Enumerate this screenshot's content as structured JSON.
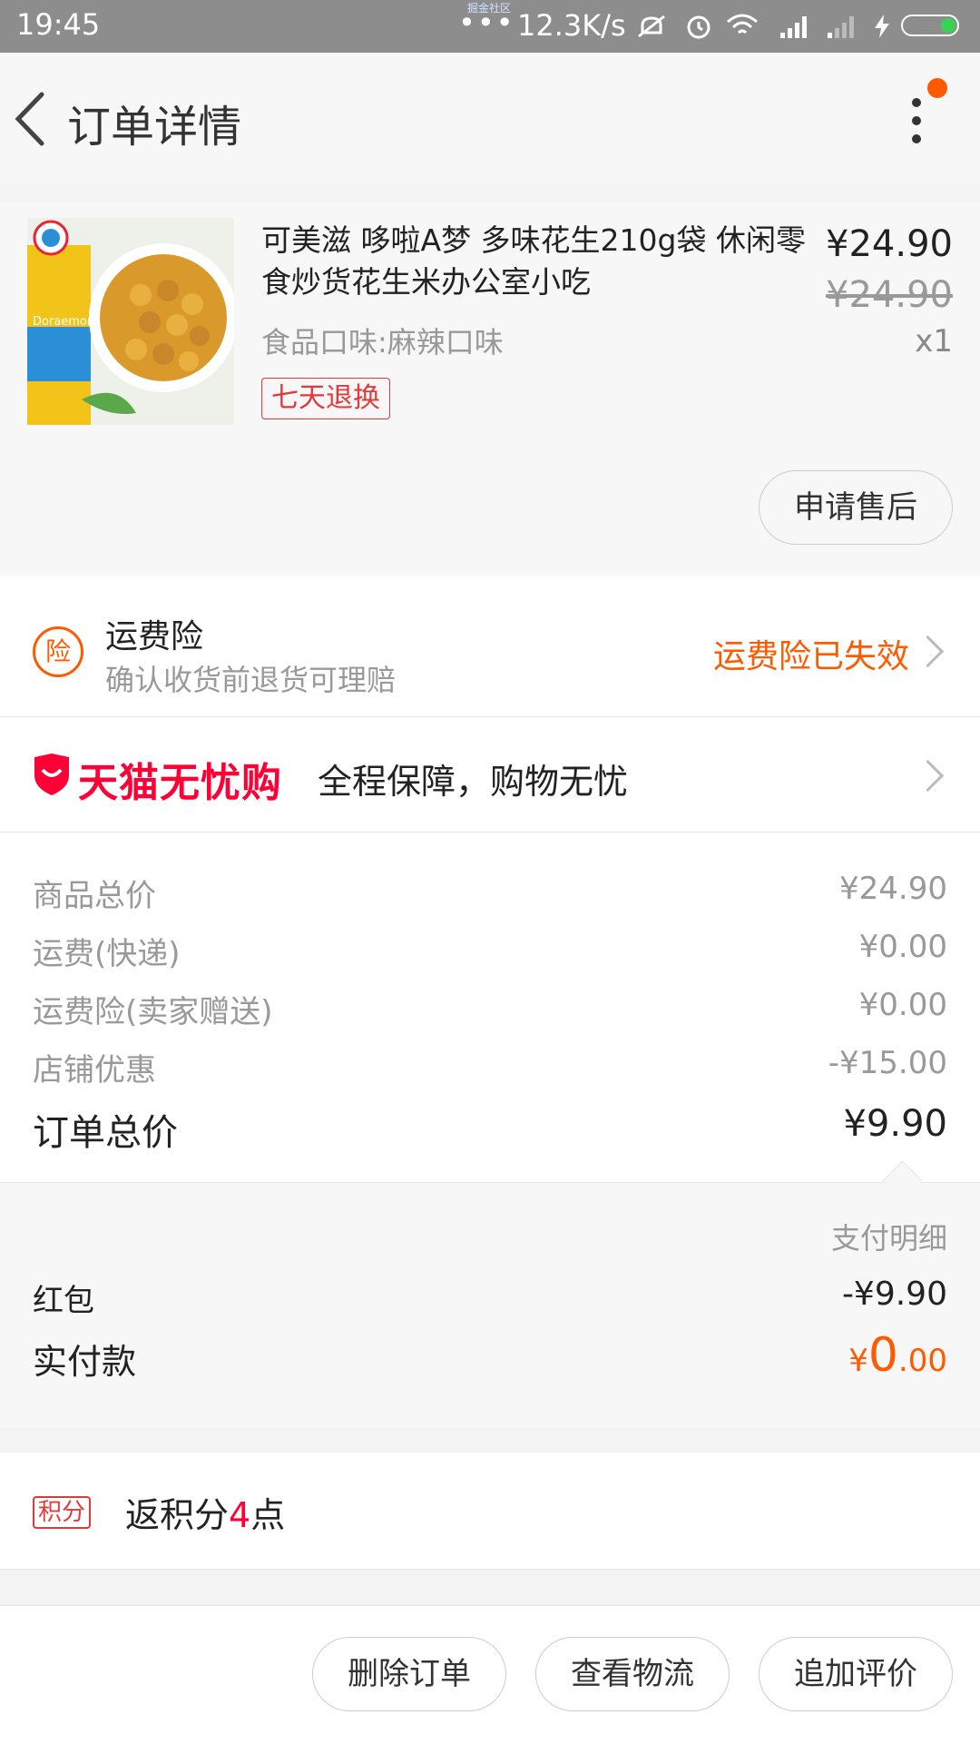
{
  "status_bar": {
    "time": "19:45",
    "tiny_text": "掘金社区",
    "dots": "•••",
    "network_speed": "12.3K/s",
    "battery_level_percent": 20
  },
  "header": {
    "title": "订单详情"
  },
  "product": {
    "title": "可美滋 哆啦A梦 多味花生210g袋 休闲零食炒货花生米办公室小吃",
    "spec": "食品口味:麻辣口味",
    "tag": "七天退换",
    "price": "¥24.90",
    "original_price": "¥24.90",
    "quantity": "x1",
    "after_sale_button": "申请售后",
    "thumb_brand_text": "Doraemon"
  },
  "freight_insurance": {
    "icon_label": "险",
    "title": "运费险",
    "subtitle": "确认收货前退货可理赔",
    "status": "运费险已失效"
  },
  "worry_free": {
    "brand": "天猫无忧购",
    "slogan": "全程保障，购物无忧"
  },
  "summary": {
    "rows": [
      {
        "label": "商品总价",
        "value": "¥24.90"
      },
      {
        "label": "运费(快递)",
        "value": "¥0.00"
      },
      {
        "label": "运费险(卖家赠送)",
        "value": "¥0.00"
      },
      {
        "label": "店铺优惠",
        "value": "-¥15.00"
      }
    ],
    "total_label": "订单总价",
    "total_value": "¥9.90"
  },
  "payment_detail": {
    "heading": "支付明细",
    "red_packet_label": "红包",
    "red_packet_value": "-¥9.90",
    "paid_label": "实付款",
    "paid_currency": "¥",
    "paid_integer": "0",
    "paid_decimal": ".00"
  },
  "points": {
    "badge": "积分",
    "text_prefix": "返积分",
    "count": "4",
    "text_suffix": "点"
  },
  "bottom_bar": {
    "delete_order": "删除订单",
    "view_logistics": "查看物流",
    "add_review": "追加评价"
  },
  "colors": {
    "accent_orange": "#ff5a00",
    "tmall_red": "#ff0036",
    "tag_red": "#e4393c"
  }
}
